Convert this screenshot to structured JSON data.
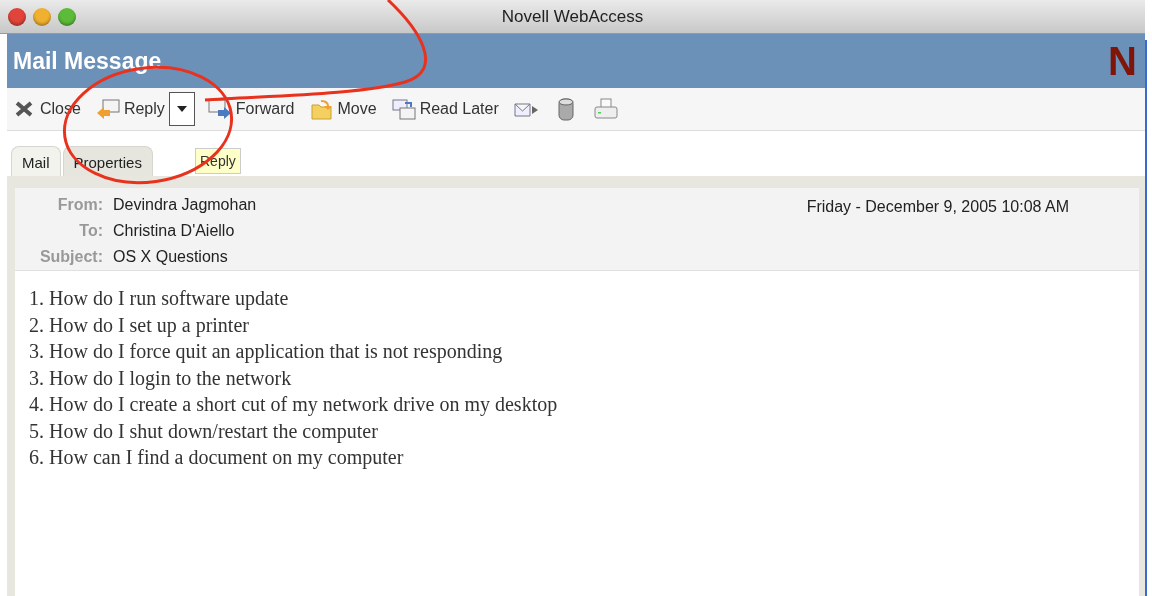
{
  "window": {
    "title": "Novell WebAccess"
  },
  "header": {
    "title": "Mail Message",
    "logo": "N"
  },
  "toolbar": [
    {
      "kind": "labeled",
      "label": "Close"
    },
    {
      "kind": "split",
      "label": "Reply"
    },
    {
      "kind": "labeled",
      "label": "Forward"
    },
    {
      "kind": "labeled",
      "label": "Move"
    },
    {
      "kind": "labeled",
      "label": "Read Later"
    },
    {
      "kind": "icon"
    },
    {
      "kind": "icon"
    },
    {
      "kind": "icon"
    }
  ],
  "tabs": [
    {
      "label": "Mail",
      "selected": true
    },
    {
      "label": "Properties",
      "selected": false
    }
  ],
  "tooltip": "Reply",
  "message": {
    "fields": [
      {
        "label": "From:",
        "value": "Devindra Jagmohan"
      },
      {
        "label": "To:",
        "value": "Christina D'Aiello"
      },
      {
        "label": "Subject:",
        "value": "OS X Questions"
      }
    ],
    "date": "Friday - December 9, 2005 10:08 AM",
    "body": [
      "1. How do I run software update",
      "2. How do I set up a printer",
      "3. How do I force quit an application that is not responding",
      "3. How do I login to the network",
      "4. How do I create a short cut of my network drive on my desktop",
      "5. How do I shut down/restart the computer",
      "6. How can I find a document on my computer"
    ]
  }
}
